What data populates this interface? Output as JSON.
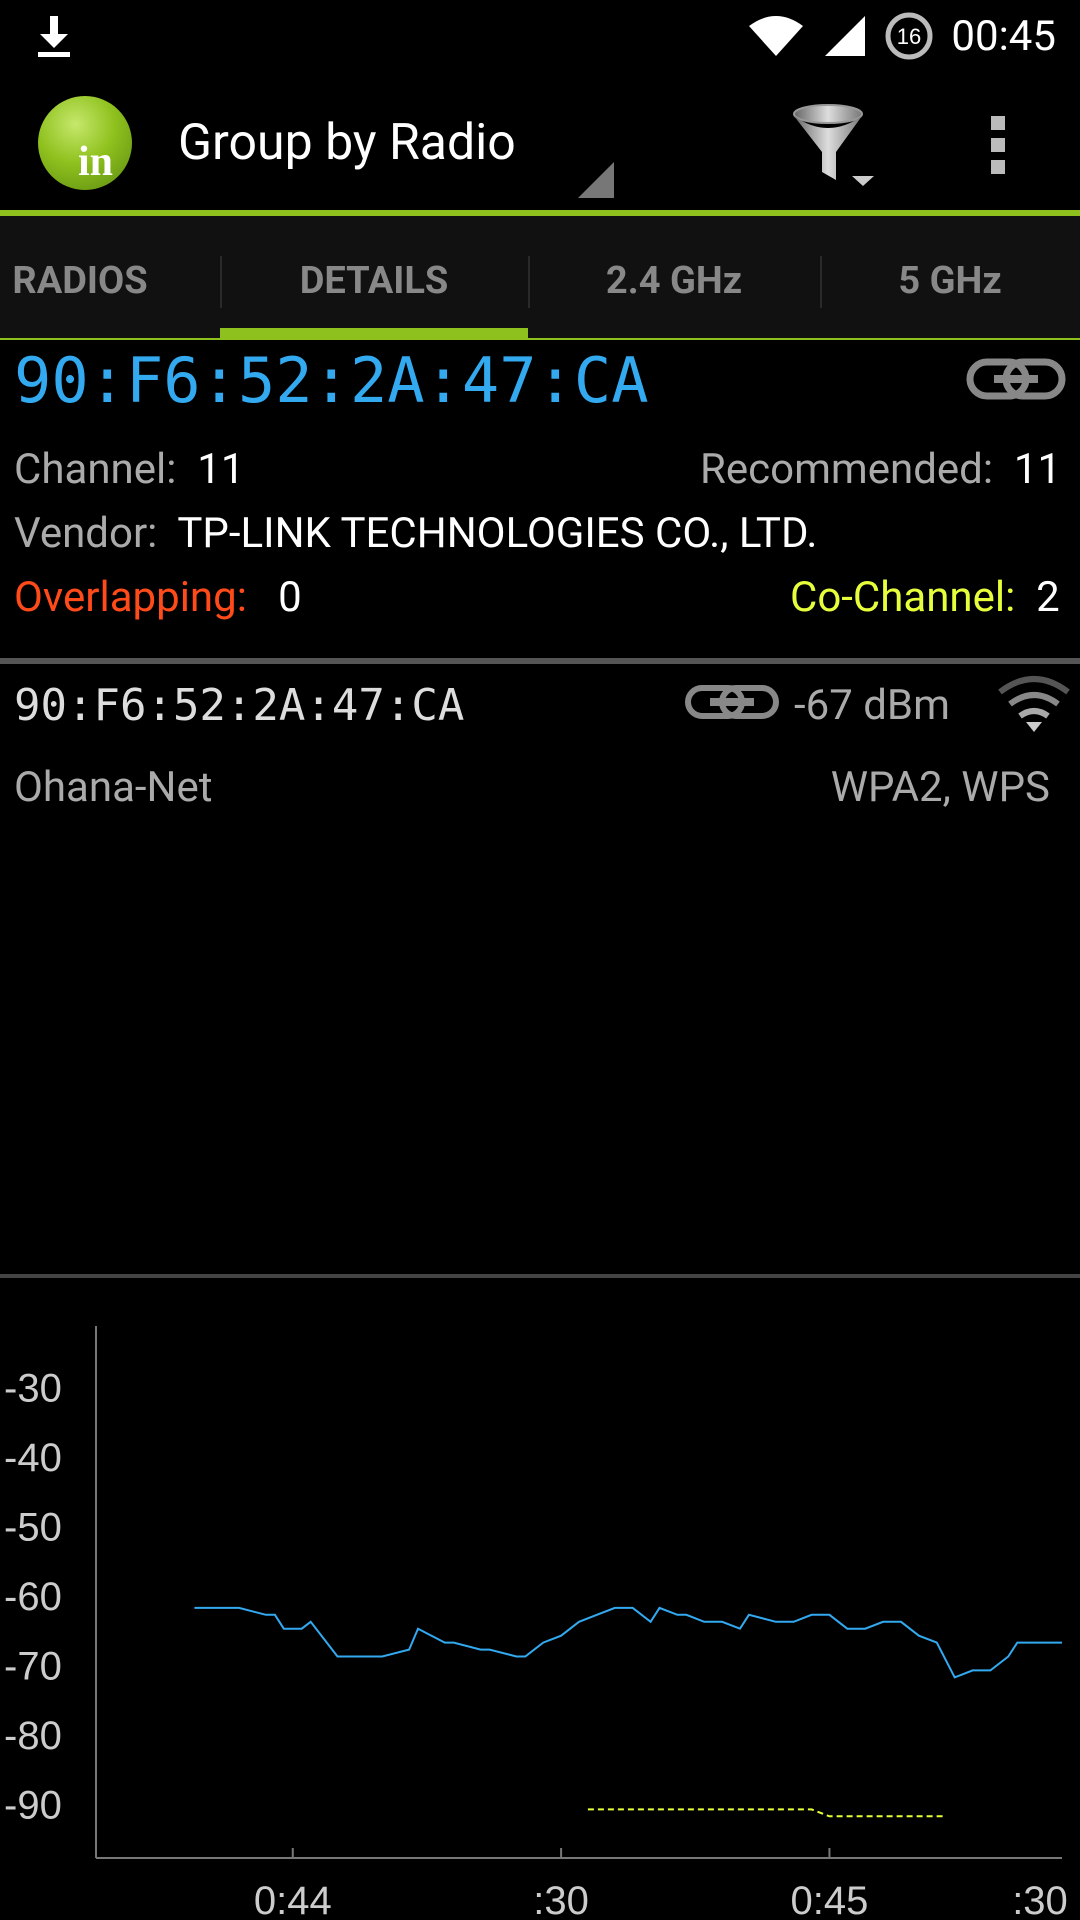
{
  "status_bar": {
    "time": "00:45",
    "notification_count": "16",
    "icons": [
      "download-icon",
      "wifi-signal-icon",
      "cell-signal-icon",
      "notification-badge-icon"
    ]
  },
  "action_bar": {
    "logo_text": "in",
    "title": "Group by Radio",
    "icons": [
      "filter-icon",
      "overflow-menu-icon"
    ]
  },
  "tabs": {
    "items": [
      {
        "label": "RADIOS"
      },
      {
        "label": "DETAILS"
      },
      {
        "label": "2.4 GHz"
      },
      {
        "label": "5 GHz"
      }
    ],
    "selected": "DETAILS"
  },
  "details": {
    "mac": "90:F6:52:2A:47:CA",
    "channel_label": "Channel:",
    "channel_value": "11",
    "recommended_label": "Recommended:",
    "recommended_value": "11",
    "vendor_label": "Vendor:",
    "vendor_value": "TP-LINK TECHNOLOGIES CO., LTD.",
    "overlapping_label": "Overlapping:",
    "overlapping_value": "0",
    "cochannel_label": "Co-Channel:",
    "cochannel_value": "2"
  },
  "radio_item": {
    "mac": "90:F6:52:2A:47:CA",
    "signal": "-67 dBm",
    "ssid": "Ohana-Net",
    "security": "WPA2, WPS"
  },
  "colors": {
    "accent_green": "#8fc11e",
    "mac_blue": "#33a9f0",
    "overlapping_red": "#ff4a1a",
    "cochannel_yellow": "#e6ff3a"
  },
  "chart_data": {
    "type": "line",
    "ylim": [
      -98,
      -22
    ],
    "xlim": [
      0,
      54
    ],
    "y_ticks": [
      -30,
      -40,
      -50,
      -60,
      -70,
      -80,
      -90
    ],
    "x_ticks": [
      {
        "x": 11,
        "label": "0:44"
      },
      {
        "x": 26,
        "label": ":30"
      },
      {
        "x": 41,
        "label": "0:45"
      },
      {
        "x": 56,
        "label": ":30"
      }
    ],
    "series": [
      {
        "color": "#33a9f0",
        "dash": false,
        "points": [
          [
            5.5,
            -62
          ],
          [
            8,
            -62
          ],
          [
            9.5,
            -63
          ],
          [
            10,
            -63
          ],
          [
            10.5,
            -65
          ],
          [
            11.5,
            -65
          ],
          [
            12,
            -64
          ],
          [
            13.5,
            -69
          ],
          [
            16,
            -69
          ],
          [
            17.5,
            -68
          ],
          [
            18,
            -65
          ],
          [
            19.5,
            -67
          ],
          [
            20,
            -67
          ],
          [
            21.5,
            -68
          ],
          [
            22,
            -68
          ],
          [
            23.5,
            -69
          ],
          [
            24,
            -69
          ],
          [
            25,
            -67
          ],
          [
            26,
            -66
          ],
          [
            27,
            -64
          ],
          [
            28,
            -63
          ],
          [
            29,
            -62
          ],
          [
            30,
            -62
          ],
          [
            31,
            -64
          ],
          [
            31.5,
            -62
          ],
          [
            32.5,
            -63
          ],
          [
            33,
            -63
          ],
          [
            34,
            -64
          ],
          [
            35,
            -64
          ],
          [
            36,
            -65
          ],
          [
            36.5,
            -63
          ],
          [
            38,
            -64
          ],
          [
            39,
            -64
          ],
          [
            40,
            -63
          ],
          [
            41,
            -63
          ],
          [
            42,
            -65
          ],
          [
            43,
            -65
          ],
          [
            44,
            -64
          ],
          [
            45,
            -64
          ],
          [
            46,
            -66
          ],
          [
            47,
            -67
          ],
          [
            48,
            -72
          ],
          [
            49,
            -71
          ],
          [
            50,
            -71
          ],
          [
            51,
            -69
          ],
          [
            51.5,
            -67
          ],
          [
            54,
            -67
          ],
          [
            59,
            -67
          ]
        ]
      },
      {
        "color": "#e6ff3a",
        "dash": true,
        "points": [
          [
            27.5,
            -91
          ],
          [
            30,
            -91
          ],
          [
            40,
            -91
          ],
          [
            41,
            -92
          ],
          [
            43,
            -92
          ],
          [
            47.5,
            -92
          ]
        ]
      }
    ]
  }
}
